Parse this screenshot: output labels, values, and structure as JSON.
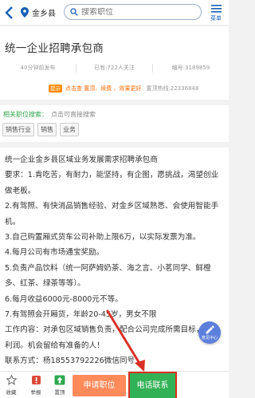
{
  "header": {
    "location": "金乡县",
    "search_placeholder": "搜索职位",
    "menu_label": "菜单"
  },
  "job": {
    "title": "统一企业招聘承包商",
    "meta": [
      "40分钟前发布",
      "已有:722人关注",
      "编号:3189859"
    ],
    "warning_badge": "提示",
    "warning_text": "点击查 置顶、续费 、效果更好",
    "warning_hotline": "置顶热线:22336848"
  },
  "related": {
    "title": "相关职位搜索：",
    "hint": "点击可直接搜索",
    "tags": [
      "销售行业",
      "销售",
      "业务"
    ]
  },
  "description": [
    "统一企业金乡县区域业务发展需求招聘承包商",
    "要求：1.肯吃苦，有耐力，能坚持，有企图，愿挑战，渴望创业做老板。",
    "2.有驾照、有快消品销售经验、对金乡区域熟悉、会使用智能手机。",
    "3.自己购置厢式货车公司补助上限6万，以实际发票为准。",
    "4.每月公司有市场通宝奖励。",
    "5.负责产品饮料（统一阿萨姆奶茶、海之言、小茗同学、鲜橙多、红茶、绿茶等等）。",
    "6.每月收益6000元-8000元不等。",
    "7.有驾照会开厢货，年龄20-45岁，男女不限",
    "工作内容：对承包区域销售负责，配合公司完成所需目标，丰厚利润。机会留给有准备的人！",
    "联系方式：杨18553792226微信同号"
  ],
  "float_button": "意见中心",
  "bottom": {
    "favorite": "收藏",
    "report": "举报",
    "share": "置顶",
    "apply": "申请职位",
    "call": "电话联系"
  },
  "colors": {
    "accent": "#1a5fb4",
    "call_green": "#33b156",
    "apply_orange": "#ff8a5a",
    "annotation_red": "#d93025"
  }
}
